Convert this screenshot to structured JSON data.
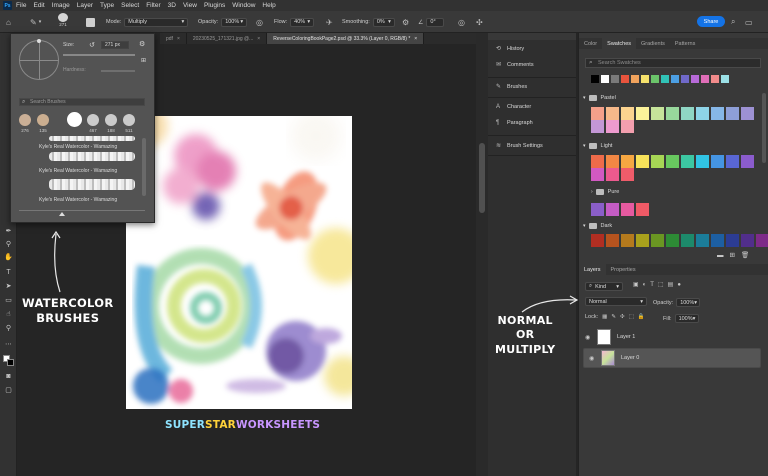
{
  "menubar": {
    "items": [
      "File",
      "Edit",
      "Image",
      "Layer",
      "Type",
      "Select",
      "Filter",
      "3D",
      "View",
      "Plugins",
      "Window",
      "Help"
    ]
  },
  "options": {
    "brush_size": "271",
    "mode_label": "Mode:",
    "mode_value": "Multiply",
    "opacity_label": "Opacity:",
    "opacity_value": "100%",
    "flow_label": "Flow:",
    "flow_value": "40%",
    "smoothing_label": "Smoothing:",
    "smoothing_value": "0%",
    "angle_value": "0°",
    "share_label": "Share"
  },
  "tabs": [
    {
      "label": "pdf",
      "active": false
    },
    {
      "label": "20230525_171321.jpg @...",
      "active": false
    },
    {
      "label": "ReverseColoringBookPage2.psd @ 33.3% (Layer 0, RGB/8) *",
      "active": true
    }
  ],
  "brush_panel": {
    "size_label": "Size:",
    "size_value": "271 px",
    "hardness_label": "Hardness:",
    "search_placeholder": "Search Brushes",
    "presets": [
      "276",
      "135",
      "",
      "467",
      "188",
      "511"
    ],
    "items": [
      "Kyle's Real Watercolor - Wamazing",
      "Kyle's Real Watercolor - Wamazing",
      "Kyle's Real Watercolor - Wamazing"
    ]
  },
  "mid_panels": {
    "items": [
      "History",
      "Comments",
      "Brushes",
      "Character",
      "Paragraph",
      "Brush Settings"
    ],
    "icons": [
      "history-icon",
      "comments-icon",
      "brushes-icon",
      "character-icon",
      "paragraph-icon",
      "brush-settings-icon"
    ]
  },
  "swatches_panel": {
    "tabs": [
      "Color",
      "Swatches",
      "Gradients",
      "Patterns"
    ],
    "active_tab": "Swatches",
    "search_placeholder": "Search Swatches",
    "recent": [
      "#000000",
      "#ffffff",
      "#7a7a7a",
      "#e8543d",
      "#f1a35d",
      "#f6e26c",
      "#6bc46a",
      "#31c2b6",
      "#4c9fe3",
      "#7069c9",
      "#b76ad8",
      "#e06eb8",
      "#f28b8b",
      "#9be0e6"
    ],
    "groups": [
      {
        "name": "Pastel",
        "colors": [
          "#f4a08a",
          "#f6b98a",
          "#fbd38f",
          "#fbf29a",
          "#c6e49a",
          "#98d89c",
          "#8fd6c4",
          "#8ed4e8",
          "#86b7e8",
          "#8e9fd8",
          "#9d91d3",
          "#c397d6",
          "#ee9bcf",
          "#f39fae"
        ]
      },
      {
        "name": "Light",
        "colors": [
          "#ee6b4a",
          "#f28744",
          "#f6a742",
          "#f7e25a",
          "#a7d655",
          "#68c85f",
          "#3cc7a2",
          "#31c4e4",
          "#4595e3",
          "#5966d4",
          "#8b5ccd",
          "#d259c2",
          "#ec5a8e",
          "#ef5c6a"
        ]
      },
      {
        "name": "Pure",
        "colors": [
          "#8a5ec8",
          "#c45cc4",
          "#e65aa0",
          "#ef5a66"
        ]
      },
      {
        "name": "Dark",
        "colors": [
          "#b12e22",
          "#b6531e",
          "#b57a1d",
          "#a9a11c",
          "#6a9622",
          "#2d8b35",
          "#1d8a6b",
          "#1b7d9a",
          "#1d5fa2",
          "#2c3c93",
          "#512e8b",
          "#7e2b88"
        ]
      }
    ]
  },
  "layers_panel": {
    "tabs": [
      "Layers",
      "Properties"
    ],
    "active_tab": "Layers",
    "kind_label": "Kind",
    "blend_mode": "Normal",
    "opacity_label": "Opacity:",
    "opacity_value": "100%",
    "lock_label": "Lock:",
    "fill_label": "Fill:",
    "fill_value": "100%",
    "layers": [
      {
        "name": "Layer 1",
        "selected": false
      },
      {
        "name": "Layer 0",
        "selected": true
      }
    ]
  },
  "annotations": {
    "left_line1": "WATERCOLOR",
    "left_line2": "BRUSHES",
    "right_line1": "NORMAL",
    "right_line2": "OR",
    "right_line3": "MULTIPLY"
  },
  "watermark": {
    "part1": "SUPER",
    "part2": "STAR",
    "part3": "WORKSHEETS"
  }
}
